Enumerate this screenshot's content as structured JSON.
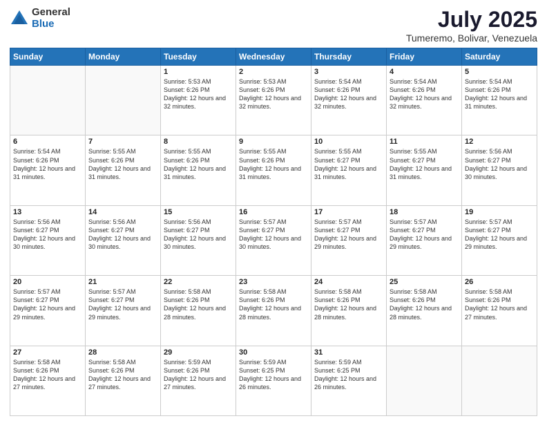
{
  "logo": {
    "general": "General",
    "blue": "Blue"
  },
  "title": "July 2025",
  "subtitle": "Tumeremo, Bolivar, Venezuela",
  "days_of_week": [
    "Sunday",
    "Monday",
    "Tuesday",
    "Wednesday",
    "Thursday",
    "Friday",
    "Saturday"
  ],
  "weeks": [
    [
      {
        "day": "",
        "info": ""
      },
      {
        "day": "",
        "info": ""
      },
      {
        "day": "1",
        "info": "Sunrise: 5:53 AM\nSunset: 6:26 PM\nDaylight: 12 hours and 32 minutes."
      },
      {
        "day": "2",
        "info": "Sunrise: 5:53 AM\nSunset: 6:26 PM\nDaylight: 12 hours and 32 minutes."
      },
      {
        "day": "3",
        "info": "Sunrise: 5:54 AM\nSunset: 6:26 PM\nDaylight: 12 hours and 32 minutes."
      },
      {
        "day": "4",
        "info": "Sunrise: 5:54 AM\nSunset: 6:26 PM\nDaylight: 12 hours and 32 minutes."
      },
      {
        "day": "5",
        "info": "Sunrise: 5:54 AM\nSunset: 6:26 PM\nDaylight: 12 hours and 31 minutes."
      }
    ],
    [
      {
        "day": "6",
        "info": "Sunrise: 5:54 AM\nSunset: 6:26 PM\nDaylight: 12 hours and 31 minutes."
      },
      {
        "day": "7",
        "info": "Sunrise: 5:55 AM\nSunset: 6:26 PM\nDaylight: 12 hours and 31 minutes."
      },
      {
        "day": "8",
        "info": "Sunrise: 5:55 AM\nSunset: 6:26 PM\nDaylight: 12 hours and 31 minutes."
      },
      {
        "day": "9",
        "info": "Sunrise: 5:55 AM\nSunset: 6:26 PM\nDaylight: 12 hours and 31 minutes."
      },
      {
        "day": "10",
        "info": "Sunrise: 5:55 AM\nSunset: 6:27 PM\nDaylight: 12 hours and 31 minutes."
      },
      {
        "day": "11",
        "info": "Sunrise: 5:55 AM\nSunset: 6:27 PM\nDaylight: 12 hours and 31 minutes."
      },
      {
        "day": "12",
        "info": "Sunrise: 5:56 AM\nSunset: 6:27 PM\nDaylight: 12 hours and 30 minutes."
      }
    ],
    [
      {
        "day": "13",
        "info": "Sunrise: 5:56 AM\nSunset: 6:27 PM\nDaylight: 12 hours and 30 minutes."
      },
      {
        "day": "14",
        "info": "Sunrise: 5:56 AM\nSunset: 6:27 PM\nDaylight: 12 hours and 30 minutes."
      },
      {
        "day": "15",
        "info": "Sunrise: 5:56 AM\nSunset: 6:27 PM\nDaylight: 12 hours and 30 minutes."
      },
      {
        "day": "16",
        "info": "Sunrise: 5:57 AM\nSunset: 6:27 PM\nDaylight: 12 hours and 30 minutes."
      },
      {
        "day": "17",
        "info": "Sunrise: 5:57 AM\nSunset: 6:27 PM\nDaylight: 12 hours and 29 minutes."
      },
      {
        "day": "18",
        "info": "Sunrise: 5:57 AM\nSunset: 6:27 PM\nDaylight: 12 hours and 29 minutes."
      },
      {
        "day": "19",
        "info": "Sunrise: 5:57 AM\nSunset: 6:27 PM\nDaylight: 12 hours and 29 minutes."
      }
    ],
    [
      {
        "day": "20",
        "info": "Sunrise: 5:57 AM\nSunset: 6:27 PM\nDaylight: 12 hours and 29 minutes."
      },
      {
        "day": "21",
        "info": "Sunrise: 5:57 AM\nSunset: 6:27 PM\nDaylight: 12 hours and 29 minutes."
      },
      {
        "day": "22",
        "info": "Sunrise: 5:58 AM\nSunset: 6:26 PM\nDaylight: 12 hours and 28 minutes."
      },
      {
        "day": "23",
        "info": "Sunrise: 5:58 AM\nSunset: 6:26 PM\nDaylight: 12 hours and 28 minutes."
      },
      {
        "day": "24",
        "info": "Sunrise: 5:58 AM\nSunset: 6:26 PM\nDaylight: 12 hours and 28 minutes."
      },
      {
        "day": "25",
        "info": "Sunrise: 5:58 AM\nSunset: 6:26 PM\nDaylight: 12 hours and 28 minutes."
      },
      {
        "day": "26",
        "info": "Sunrise: 5:58 AM\nSunset: 6:26 PM\nDaylight: 12 hours and 27 minutes."
      }
    ],
    [
      {
        "day": "27",
        "info": "Sunrise: 5:58 AM\nSunset: 6:26 PM\nDaylight: 12 hours and 27 minutes."
      },
      {
        "day": "28",
        "info": "Sunrise: 5:58 AM\nSunset: 6:26 PM\nDaylight: 12 hours and 27 minutes."
      },
      {
        "day": "29",
        "info": "Sunrise: 5:59 AM\nSunset: 6:26 PM\nDaylight: 12 hours and 27 minutes."
      },
      {
        "day": "30",
        "info": "Sunrise: 5:59 AM\nSunset: 6:25 PM\nDaylight: 12 hours and 26 minutes."
      },
      {
        "day": "31",
        "info": "Sunrise: 5:59 AM\nSunset: 6:25 PM\nDaylight: 12 hours and 26 minutes."
      },
      {
        "day": "",
        "info": ""
      },
      {
        "day": "",
        "info": ""
      }
    ]
  ]
}
